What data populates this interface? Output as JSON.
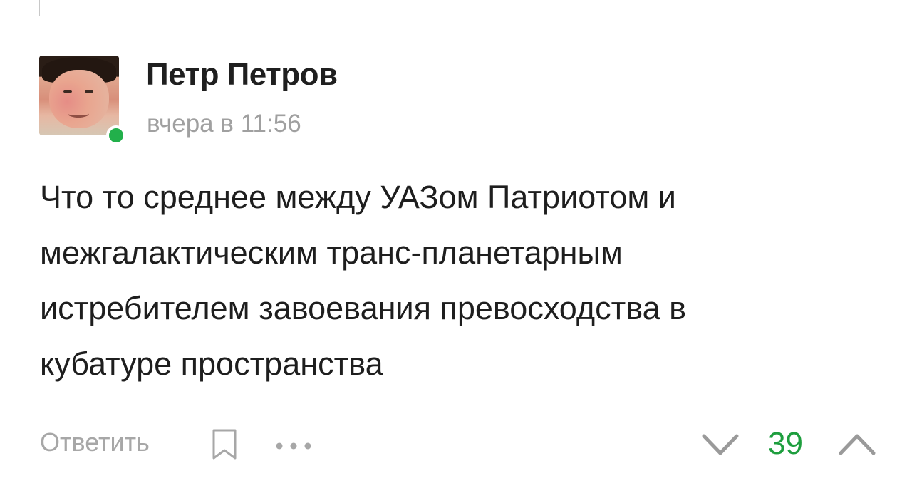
{
  "comment": {
    "author": "Петр Петров",
    "timestamp": "вчера в 11:56",
    "text_lines": [
      "Что то среднее между УАЗом Патриотом и",
      "межгалактическим транс-планетарным",
      "истребителем завоевания превосходства в",
      "кубатуре пространства"
    ],
    "online": true
  },
  "actions": {
    "reply_label": "Ответить",
    "bookmark_icon": "bookmark-icon",
    "more_icon": "more-dots-icon",
    "vote_down_icon": "chevron-down-icon",
    "vote_up_icon": "chevron-up-icon",
    "score": "39"
  },
  "colors": {
    "online": "#22b04b",
    "score": "#1e9e3e",
    "muted": "#a0a0a0",
    "text": "#1e1e1e"
  }
}
